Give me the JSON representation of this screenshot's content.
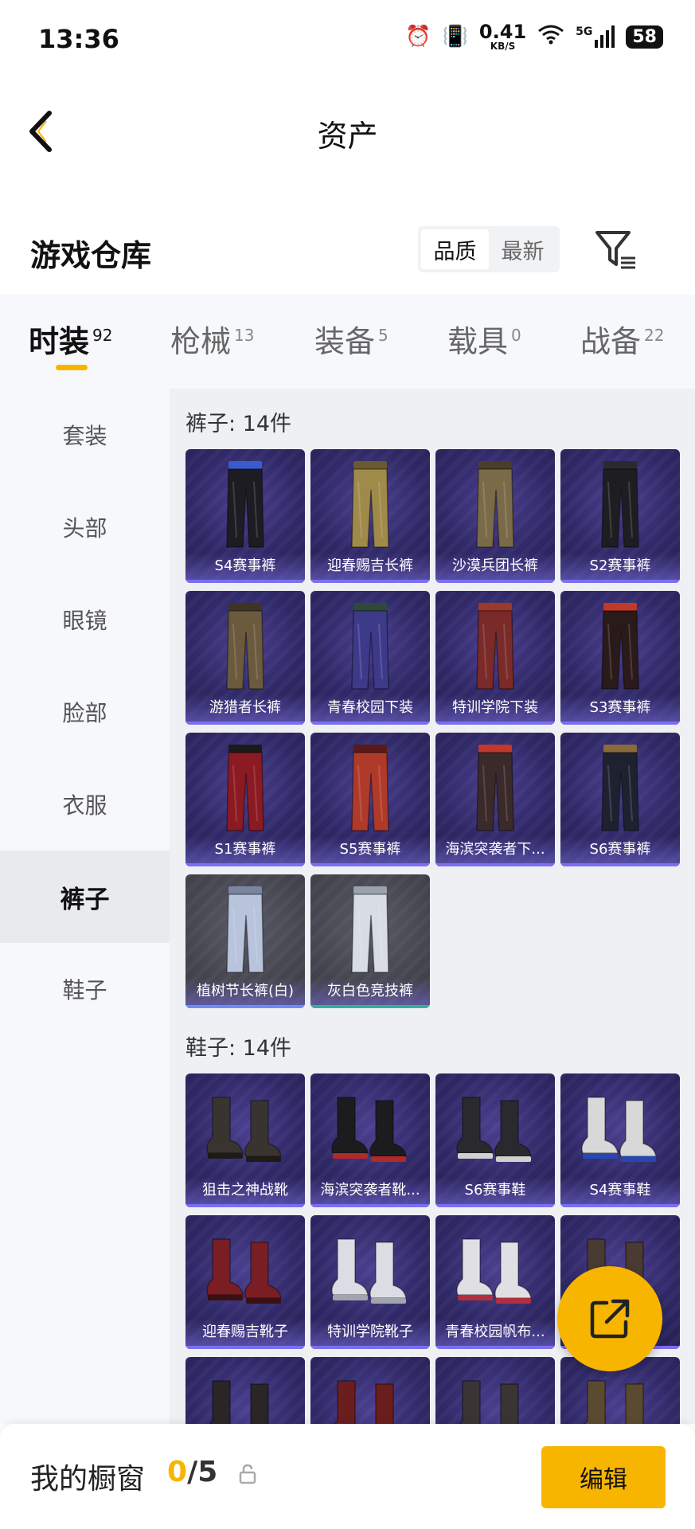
{
  "status": {
    "time": "13:36",
    "net_speed": "0.41",
    "net_unit": "KB/S",
    "signal": "5G",
    "battery": "58"
  },
  "header": {
    "title": "资产"
  },
  "section": {
    "title": "游戏仓库",
    "sort_options": [
      "品质",
      "最新"
    ],
    "sort_active": "品质"
  },
  "category_tabs": [
    {
      "label": "时装",
      "count": "92"
    },
    {
      "label": "枪械",
      "count": "13"
    },
    {
      "label": "装备",
      "count": "5"
    },
    {
      "label": "载具",
      "count": "0"
    },
    {
      "label": "战备",
      "count": "22"
    }
  ],
  "sidebar": [
    "套装",
    "头部",
    "眼镜",
    "脸部",
    "衣服",
    "裤子",
    "鞋子"
  ],
  "sidebar_active": "裤子",
  "groups": [
    {
      "title": "裤子: 14件",
      "items": [
        "S4赛事裤",
        "迎春赐吉长裤",
        "沙漠兵团长裤",
        "S2赛事裤",
        "游猎者长裤",
        "青春校园下装",
        "特训学院下装",
        "S3赛事裤",
        "S1赛事裤",
        "S5赛事裤",
        "海滨突袭者下...",
        "S6赛事裤",
        "植树节长裤(白)",
        "灰白色竞技裤"
      ]
    },
    {
      "title": "鞋子: 14件",
      "items": [
        "狙击之神战靴",
        "海滨突袭者靴...",
        "S6赛事鞋",
        "S4赛事鞋",
        "迎春赐吉靴子",
        "特训学院靴子",
        "青春校园帆布...",
        "",
        "",
        "",
        "",
        ""
      ]
    }
  ],
  "bottom": {
    "label": "我的橱窗",
    "current": "0",
    "total": "/5",
    "edit": "编辑"
  },
  "colors": {
    "accent": "#f7b500",
    "card_purple": "#2f2866",
    "card_gray": "#45454f"
  }
}
